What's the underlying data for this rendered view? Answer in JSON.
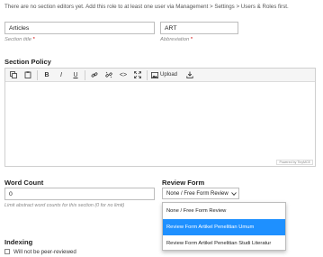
{
  "notice": "There are no section editors yet. Add this role to at least one user via Management > Settings > Users & Roles first.",
  "section_title": {
    "value": "Articles",
    "label": "Section title",
    "required_mark": "*"
  },
  "abbreviation": {
    "value": "ART",
    "label": "Abbreviation",
    "required_mark": "*"
  },
  "section_policy": {
    "heading": "Section Policy",
    "toolbar": {
      "copy_icon": "copy-icon",
      "paste_icon": "paste-icon",
      "bold": "B",
      "italic": "I",
      "underline": "U",
      "link_icon": "link-icon",
      "unlink_icon": "unlink-icon",
      "code": "<>",
      "fullscreen_icon": "fullscreen-icon",
      "upload_label": "Upload",
      "download_icon": "download-icon"
    },
    "powered_by": "Powered by TinyMCE"
  },
  "word_count": {
    "heading": "Word Count",
    "value": "0",
    "hint": "Limit abstract word counts for this section (0 for no limit)"
  },
  "review_form": {
    "heading": "Review Form",
    "selected": "None / Free Form Review",
    "options": [
      "None / Free Form Review",
      "Review Form Artikel Penelitian Umum",
      "Review Form Artikel Penelitian Studi Literatur"
    ],
    "highlighted_index": 1
  },
  "indexing": {
    "heading": "Indexing",
    "checkbox_label": "Will not be peer-reviewed",
    "checked": false
  }
}
